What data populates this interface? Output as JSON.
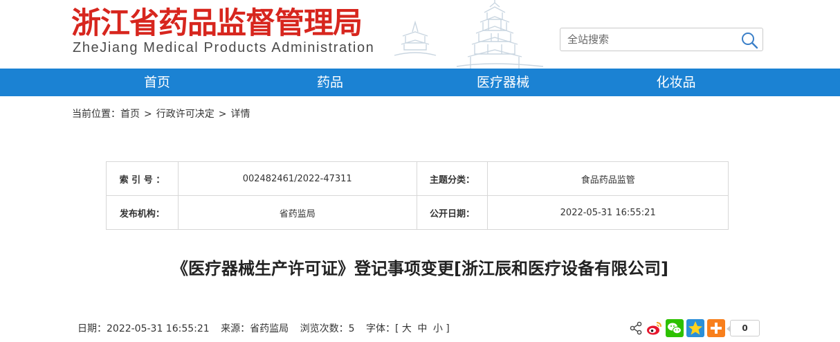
{
  "header": {
    "logo_cn": "浙江省药品监督管理局",
    "logo_en": "ZheJiang Medical Products Administration",
    "search_placeholder": "全站搜索"
  },
  "nav": {
    "items": [
      {
        "label": "首页"
      },
      {
        "label": "药品"
      },
      {
        "label": "医疗器械"
      },
      {
        "label": "化妆品"
      }
    ]
  },
  "breadcrumb": {
    "prefix": "当前位置：",
    "items": [
      "首页",
      "行政许可决定",
      "详情"
    ],
    "separator": ">"
  },
  "info": {
    "index_label": "索 引 号 ：",
    "index_value": "002482461/2022-47311",
    "category_label": "主题分类：",
    "category_value": "食品药品监管",
    "publisher_label": "发布机构：",
    "publisher_value": "省药监局",
    "date_label": "公开日期：",
    "date_value": "2022-05-31 16:55:21"
  },
  "doc": {
    "title": "《医疗器械生产许可证》登记事项变更[浙江辰和医疗设备有限公司]"
  },
  "meta": {
    "date": "日期：2022-05-31 16:55:21",
    "source": "来源：省药监局",
    "views": "浏览次数：5",
    "font_prefix": "字体：[",
    "font_large": "大",
    "font_medium": "中",
    "font_small": "小",
    "font_suffix": "]"
  },
  "share": {
    "count": "0",
    "icons": [
      "share-icon",
      "weibo-icon",
      "wechat-icon",
      "qzone-icon",
      "more-share-icon"
    ]
  },
  "colors": {
    "brand_red": "#d7261e",
    "nav_blue": "#1b82d3"
  }
}
